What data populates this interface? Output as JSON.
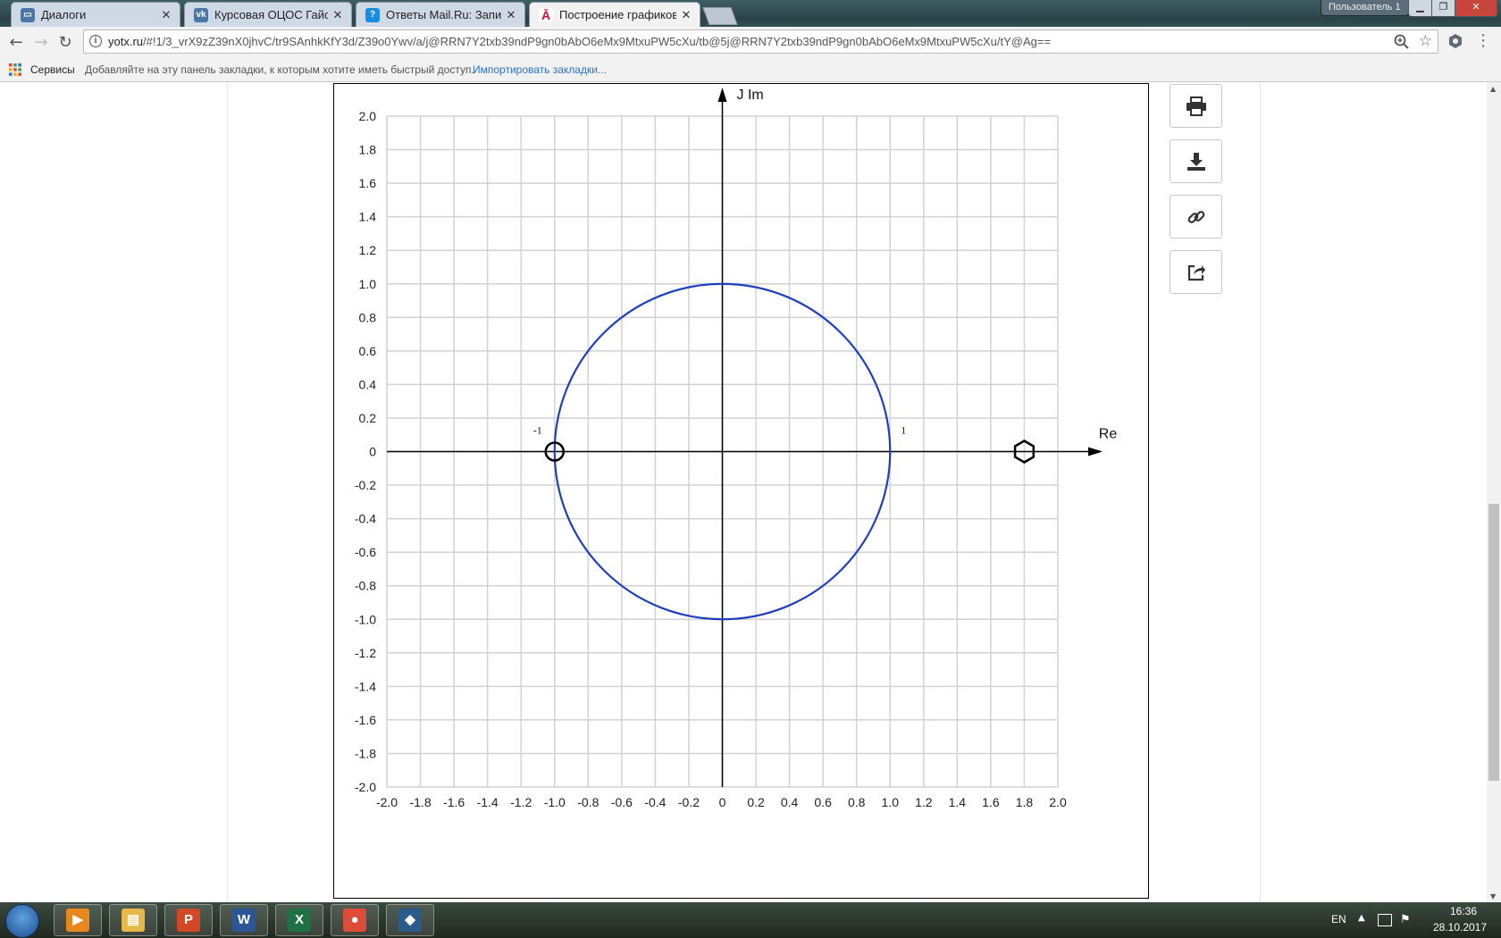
{
  "browser": {
    "tabs": [
      {
        "title": "Диалоги",
        "icon": "chat-bubble-icon",
        "active": false
      },
      {
        "title": "Курсовая ОЦОС Гайсан",
        "icon": "vk-icon",
        "active": false
      },
      {
        "title": "Ответы Mail.Ru: Запиши",
        "icon": "question-icon",
        "active": false
      },
      {
        "title": "Построение графиков ф",
        "icon": "yotx-icon",
        "active": true
      }
    ],
    "profile_label": "Пользователь 1",
    "url": "yotx.ru",
    "url_path": "/#!1/3_vrX9zZ39nX0jhvC/tr9SAnhkKfY3d/Z39o0Ywv/a/j@RRN7Y2txb39ndP9gn0bAbO6eMx9MtxuPW5cXu/tb@5j@RRN7Y2txb39ndP9gn0bAbO6eMx9MtxuPW5cXu/tY@Ag==",
    "bookmarks": {
      "apps_label": "Сервисы",
      "hint": "Добавляйте на эту панель закладки, к которым хотите иметь быстрый доступ.",
      "import_link": "Импортировать закладки..."
    }
  },
  "side_buttons": [
    {
      "name": "print-button",
      "icon": "printer-icon"
    },
    {
      "name": "download-button",
      "icon": "download-icon"
    },
    {
      "name": "link-button",
      "icon": "link-icon"
    },
    {
      "name": "share-button",
      "icon": "share-icon"
    }
  ],
  "chart_data": {
    "type": "scatter",
    "title": "",
    "xlabel": "Re",
    "ylabel": "J Im",
    "xlim": [
      -2.0,
      2.0
    ],
    "ylim": [
      -2.0,
      2.0
    ],
    "grid": true,
    "x_ticks": [
      "-2.0",
      "-1.8",
      "-1.6",
      "-1.4",
      "-1.2",
      "-1.0",
      "-0.8",
      "-0.6",
      "-0.4",
      "-0.2",
      "0",
      "0.2",
      "0.4",
      "0.6",
      "0.8",
      "1.0",
      "1.2",
      "1.4",
      "1.6",
      "1.8",
      "2.0"
    ],
    "y_ticks": [
      "2.0",
      "1.8",
      "1.6",
      "1.4",
      "1.2",
      "1.0",
      "0.8",
      "0.6",
      "0.4",
      "0.2",
      "0",
      "-0.2",
      "-0.4",
      "-0.6",
      "-0.8",
      "-1.0",
      "-1.2",
      "-1.4",
      "-1.6",
      "-1.8",
      "-2.0"
    ],
    "unit_circle": {
      "center": [
        0,
        0
      ],
      "radius": 1,
      "color": "#1f3fbf"
    },
    "point_labels": [
      {
        "text": "-1",
        "x": -1,
        "y": 0
      },
      {
        "text": "1",
        "x": 1,
        "y": 0
      }
    ],
    "markers": [
      {
        "shape": "circle",
        "x": -1.0,
        "y": 0
      },
      {
        "shape": "hexagon",
        "x": 1.8,
        "y": 0
      }
    ]
  },
  "taskbar": {
    "apps": [
      {
        "name": "media-player",
        "icon": "media-player-icon",
        "color": "#e8871e",
        "glyph": "▶"
      },
      {
        "name": "file-explorer",
        "icon": "folder-icon",
        "color": "#e6b84a",
        "glyph": "▤"
      },
      {
        "name": "powerpoint",
        "icon": "powerpoint-icon",
        "color": "#d24726",
        "glyph": "P"
      },
      {
        "name": "word",
        "icon": "word-icon",
        "color": "#2b5797",
        "glyph": "W"
      },
      {
        "name": "excel",
        "icon": "excel-icon",
        "color": "#1e7145",
        "glyph": "X"
      },
      {
        "name": "chrome",
        "icon": "chrome-icon",
        "color": "#dd4b39",
        "glyph": "●"
      },
      {
        "name": "app",
        "icon": "app-icon",
        "color": "#2a5c8a",
        "glyph": "◆"
      }
    ],
    "lang": "EN",
    "time": "16:36",
    "date": "28.10.2017"
  }
}
